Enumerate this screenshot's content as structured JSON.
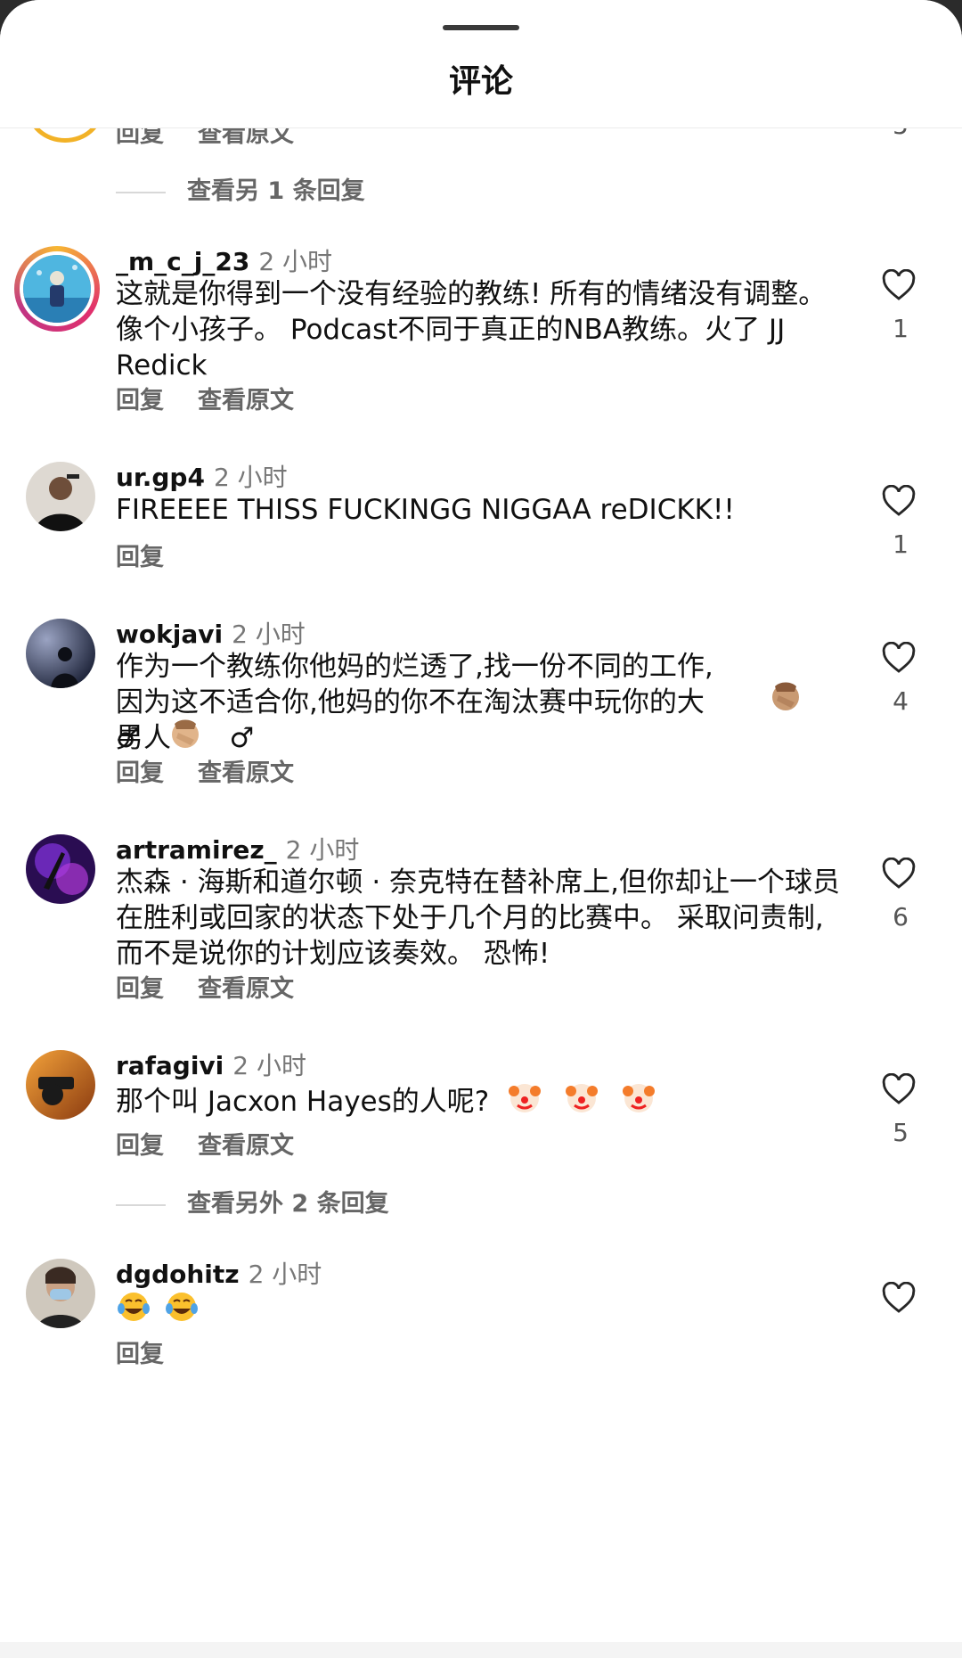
{
  "header": {
    "title": "评论"
  },
  "labels": {
    "reply": "回复",
    "translate": "查看原文"
  },
  "top_partial": {
    "likes": "5",
    "more_replies": "查看另 1 条回复"
  },
  "comments": [
    {
      "username": "_m_c_j_23",
      "time": "2 小时",
      "text": "这就是你得到一个没有经验的教练! 所有的情绪没有调整。 像个小孩子。 Podcast不同于真正的NBA教练。火了 JJ Redick",
      "likes": "1",
      "avatar_icon": "underwater-photo-avatar"
    },
    {
      "username": "ur.gp4",
      "time": "2 小时",
      "text": "FIREEEE THISS FUCKINGG NIGGAA reDICKK!!",
      "likes": "1",
      "avatar_icon": "person-photo-avatar"
    },
    {
      "username": "wokjavi",
      "time": "2 小时",
      "text": "作为一个教练你他妈的烂透了,找一份不同的工作,因为这不适合你,他妈的你不在淘汰赛中玩你的大男人",
      "text_tail": "♂",
      "likes": "4",
      "avatar_icon": "night-silhouette-avatar"
    },
    {
      "username": "artramirez_",
      "time": "2 小时",
      "text": "杰森 · 海斯和道尔顿 · 奈克特在替补席上,但你却让一个球员在胜利或回家的状态下处于几个月的比赛中。 采取问责制,而不是说你的计划应该奏效。 恐怖!",
      "likes": "6",
      "avatar_icon": "purple-abstract-avatar"
    },
    {
      "username": "rafagivi",
      "time": "2 小时",
      "text": "那个叫 Jacxon Hayes的人呢?",
      "likes": "5",
      "avatar_icon": "photographer-avatar",
      "more_replies": "查看另外 2 条回复"
    },
    {
      "username": "dgdohitz",
      "time": "2 小时",
      "text": "",
      "likes": "",
      "avatar_icon": "masked-person-avatar"
    }
  ],
  "colors": {
    "heart": "#262626",
    "ring_start": "#f7b733",
    "ring_end": "#c13584"
  }
}
